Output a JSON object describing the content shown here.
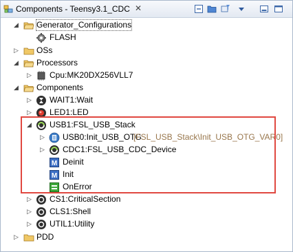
{
  "window": {
    "title": "Components - Teensy3.1_CDC",
    "close_glyph": "✕",
    "toolbar_icons": [
      "collapse-all-icon",
      "folder-link-icon",
      "filter-icon",
      "view-menu-icon",
      "minimize-icon",
      "maximize-icon"
    ]
  },
  "tree": {
    "generator": {
      "label": "Generator_Configurations",
      "children": {
        "flash": "FLASH"
      }
    },
    "oss": {
      "label": "OSs"
    },
    "processors": {
      "label": "Processors",
      "children": {
        "cpu": "Cpu:MK20DX256VLL7"
      }
    },
    "components": {
      "label": "Components",
      "children": {
        "wait": "WAIT1:Wait",
        "led": "LED1:LED",
        "usb": {
          "label": "USB1:FSL_USB_Stack",
          "children": {
            "usb0": "USB0:Init_USB_OTG",
            "usb0_suffix": "[FSL_USB_Stack\\Init_USB_OTG_VAR0]",
            "cdc": "CDC1:FSL_USB_CDC_Device",
            "deinit": "Deinit",
            "init": "Init",
            "onerror": "OnError"
          }
        },
        "cs": "CS1:CriticalSection",
        "cls": "CLS1:Shell",
        "util": "UTIL1:Utility"
      }
    },
    "pdd": {
      "label": "PDD"
    }
  },
  "colors": {
    "highlight_border": "#e0473f",
    "suffix_text": "#98764b",
    "folder": "#e8b85a"
  }
}
